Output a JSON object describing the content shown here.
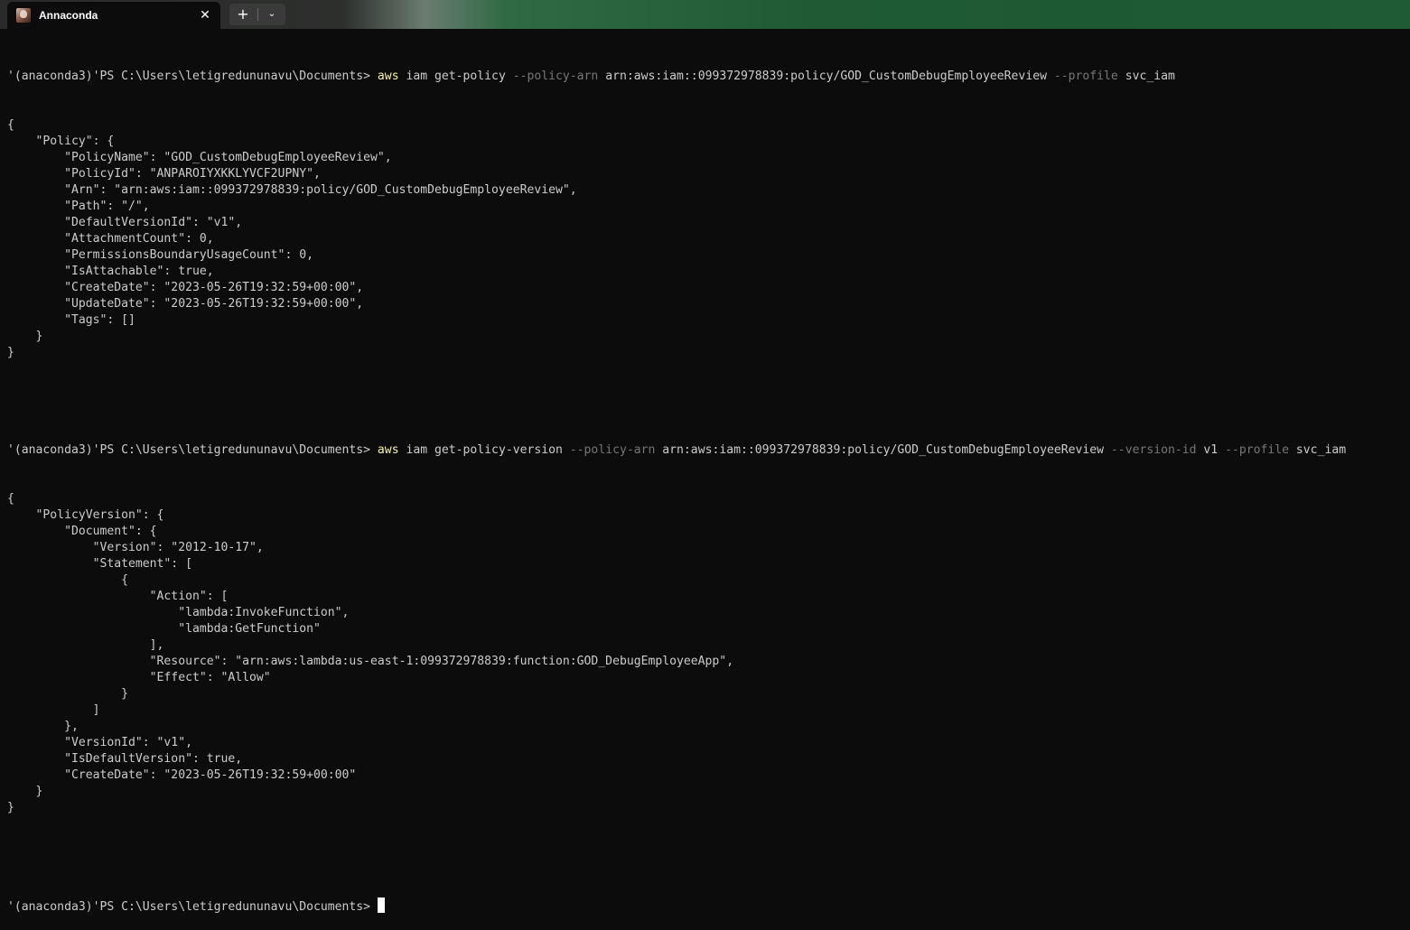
{
  "window": {
    "tab_title": "Annaconda",
    "tab_icon": "user-avatar-icon",
    "close_glyph": "✕",
    "new_tab_glyph": "+",
    "dropdown_glyph": "⌄"
  },
  "colors": {
    "background": "#0c0c0c",
    "text": "#cccccc",
    "command": "#f9f1a5",
    "parameter": "#767676",
    "titlebar_accent": "#1f5b35"
  },
  "terminal": {
    "prompt": "'(anaconda3)'PS C:\\Users\\letigredununavu\\Documents> ",
    "cmd1": {
      "program": "aws",
      "args1": " iam get-policy ",
      "flag1": "--policy-arn",
      "val1": " arn:aws:iam::099372978839:policy/GOD_CustomDebugEmployeeReview ",
      "flag2": "--profile",
      "val2": " svc_iam"
    },
    "out1": [
      "{",
      "    \"Policy\": {",
      "        \"PolicyName\": \"GOD_CustomDebugEmployeeReview\",",
      "        \"PolicyId\": \"ANPAROIYXKKLYVCF2UPNY\",",
      "        \"Arn\": \"arn:aws:iam::099372978839:policy/GOD_CustomDebugEmployeeReview\",",
      "        \"Path\": \"/\",",
      "        \"DefaultVersionId\": \"v1\",",
      "        \"AttachmentCount\": 0,",
      "        \"PermissionsBoundaryUsageCount\": 0,",
      "        \"IsAttachable\": true,",
      "        \"CreateDate\": \"2023-05-26T19:32:59+00:00\",",
      "        \"UpdateDate\": \"2023-05-26T19:32:59+00:00\",",
      "        \"Tags\": []",
      "    }",
      "}"
    ],
    "cmd2": {
      "program": "aws",
      "args1": " iam get-policy-version ",
      "flag1": "--policy-arn",
      "val1": " arn:aws:iam::099372978839:policy/GOD_CustomDebugEmployeeReview ",
      "flag2": "--version-id",
      "val2": " v1 ",
      "flag3": "--profile",
      "val3": " svc_iam"
    },
    "out2": [
      "{",
      "    \"PolicyVersion\": {",
      "        \"Document\": {",
      "            \"Version\": \"2012-10-17\",",
      "            \"Statement\": [",
      "                {",
      "                    \"Action\": [",
      "                        \"lambda:InvokeFunction\",",
      "                        \"lambda:GetFunction\"",
      "                    ],",
      "                    \"Resource\": \"arn:aws:lambda:us-east-1:099372978839:function:GOD_DebugEmployeeApp\",",
      "                    \"Effect\": \"Allow\"",
      "                }",
      "            ]",
      "        },",
      "        \"VersionId\": \"v1\",",
      "        \"IsDefaultVersion\": true,",
      "        \"CreateDate\": \"2023-05-26T19:32:59+00:00\"",
      "    }",
      "}"
    ]
  }
}
